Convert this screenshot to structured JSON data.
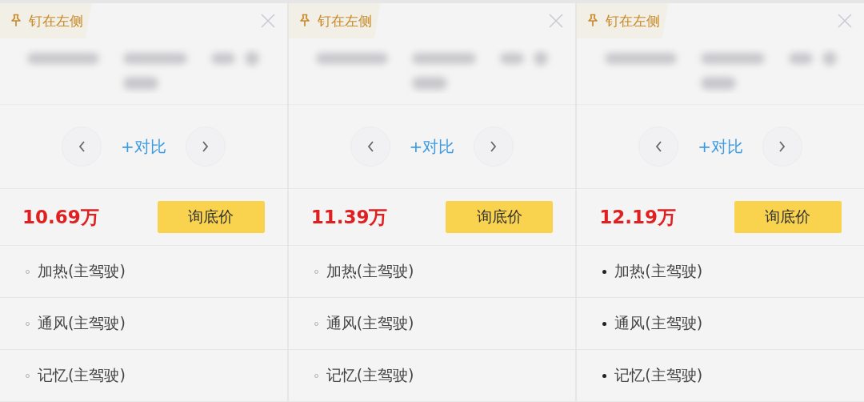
{
  "cars": [
    {
      "pin_label": "钉在左侧",
      "compare_label": "+对比",
      "price": "10.69万",
      "price_button": "询底价",
      "features": [
        {
          "label": "加热(主驾驶)",
          "kind": "optional"
        },
        {
          "label": "通风(主驾驶)",
          "kind": "optional"
        },
        {
          "label": "记忆(主驾驶)",
          "kind": "optional"
        }
      ]
    },
    {
      "pin_label": "钉在左侧",
      "compare_label": "+对比",
      "price": "11.39万",
      "price_button": "询底价",
      "features": [
        {
          "label": "加热(主驾驶)",
          "kind": "optional"
        },
        {
          "label": "通风(主驾驶)",
          "kind": "optional"
        },
        {
          "label": "记忆(主驾驶)",
          "kind": "optional"
        }
      ]
    },
    {
      "pin_label": "钉在左侧",
      "compare_label": "+对比",
      "price": "12.19万",
      "price_button": "询底价",
      "features": [
        {
          "label": "加热(主驾驶)",
          "kind": "standard"
        },
        {
          "label": "通风(主驾驶)",
          "kind": "standard"
        },
        {
          "label": "记忆(主驾驶)",
          "kind": "standard"
        }
      ]
    }
  ]
}
